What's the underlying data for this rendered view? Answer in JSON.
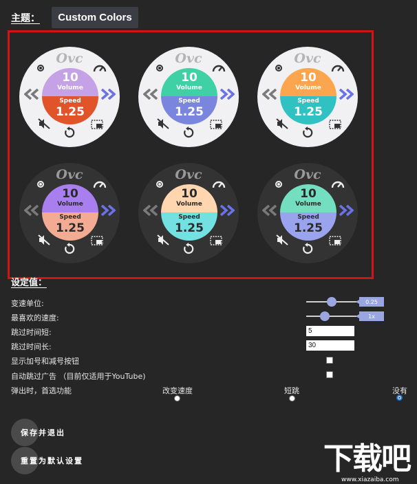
{
  "theme": {
    "label": "主题：",
    "selected": "Custom Colors"
  },
  "dial_text": {
    "brand": "Ovc",
    "volume_value": "10",
    "volume_label": "Volume",
    "speed_label": "Speed",
    "speed_value": "1.25"
  },
  "dials": [
    {
      "variant": "light",
      "top_color": "#c5a1e6",
      "bottom_color": "#e1542a"
    },
    {
      "variant": "light",
      "top_color": "#3fd1a5",
      "bottom_color": "#7a86dd"
    },
    {
      "variant": "light",
      "top_color": "#fba64f",
      "bottom_color": "#30c2c2"
    },
    {
      "variant": "dark",
      "top_color": "#a97ff0",
      "bottom_color": "#f4ab94"
    },
    {
      "variant": "dark",
      "top_color": "#ffd6b0",
      "bottom_color": "#73e1e1"
    },
    {
      "variant": "dark",
      "top_color": "#73dfc0",
      "bottom_color": "#9aa3ee"
    }
  ],
  "settings": {
    "title": "设定值：",
    "speed_step": {
      "label": "变速单位:",
      "value": "0.25",
      "fraction": 0.5
    },
    "favorite_speed": {
      "label": "最喜欢的速度:",
      "value": "1x",
      "fraction": 0.33
    },
    "skip_short": {
      "label": "跳过时间短:",
      "value": "5"
    },
    "skip_long": {
      "label": "跳过时间长:",
      "value": "30"
    },
    "show_plus_minus": {
      "label": "显示加号和减号按钮",
      "checked": false
    },
    "auto_skip_ads": {
      "label": "自动跳过广告 （目前仅适用于YouTube)",
      "checked": false
    },
    "popup_pref": {
      "label": "弹出时，首选功能",
      "options": [
        "改变速度",
        "短跳",
        "没有"
      ],
      "selected": 2
    }
  },
  "buttons": {
    "save": "保存并退出",
    "reset": "重置为默认设置"
  },
  "watermark": {
    "text": "下载吧",
    "url": "www.xiazaiba.com"
  },
  "colors": {
    "accent": "#9aa6e0",
    "frame": "#d41414",
    "rewind_grey": "#7a7a7a",
    "forward_blue": "#6a72e8"
  }
}
